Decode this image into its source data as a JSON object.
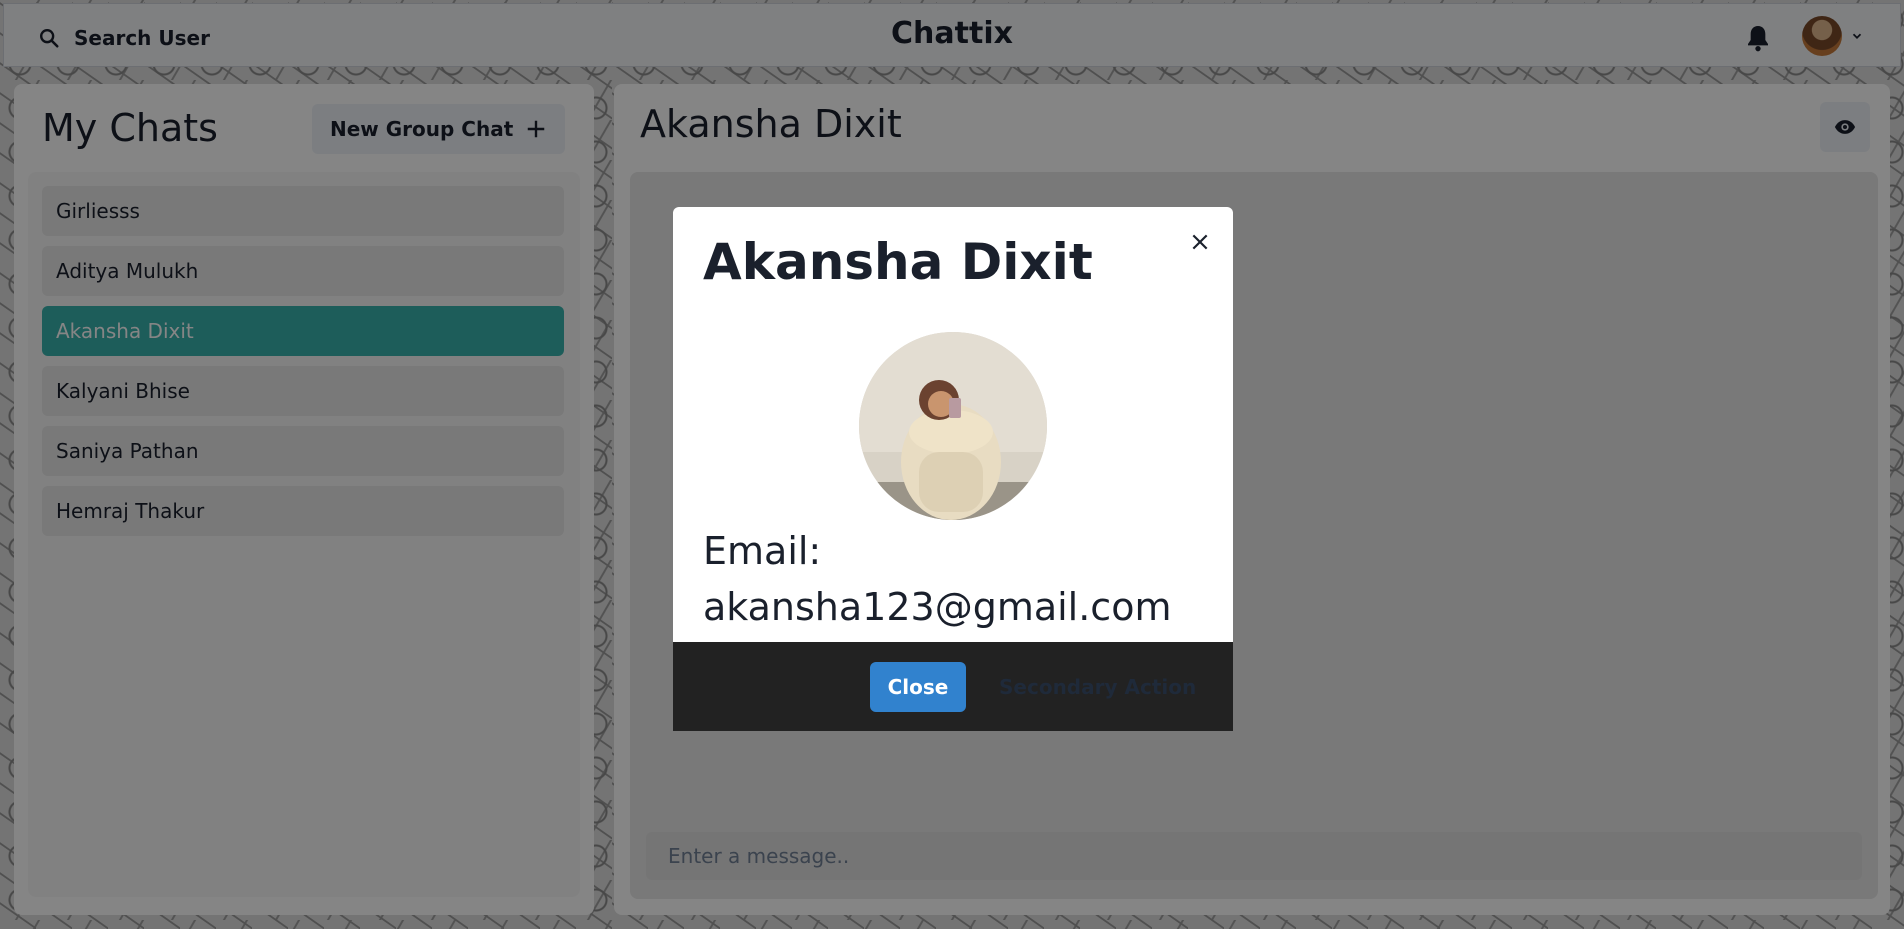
{
  "header": {
    "search_label": "Search User",
    "app_title": "Chattix"
  },
  "left_panel": {
    "title": "My Chats",
    "new_group_label": "New Group Chat",
    "chats": [
      {
        "name": "Girliesss",
        "active": false
      },
      {
        "name": "Aditya Mulukh",
        "active": false
      },
      {
        "name": "Akansha Dixit",
        "active": true
      },
      {
        "name": "Kalyani Bhise",
        "active": false
      },
      {
        "name": "Saniya Pathan",
        "active": false
      },
      {
        "name": "Hemraj Thakur",
        "active": false
      }
    ]
  },
  "chat": {
    "title": "Akansha Dixit",
    "input_placeholder": "Enter a message.."
  },
  "modal": {
    "title": "Akansha Dixit",
    "email_line1": "Email:",
    "email_line2": "akansha123@gmail.com",
    "close_label": "Close",
    "secondary_label": "Secondary Action"
  },
  "colors": {
    "active_chat": "#38b2ac",
    "close_button": "#3182ce",
    "modal_footer": "#222222"
  },
  "icons": [
    "search-icon",
    "bell-icon",
    "chevron-down-icon",
    "plus-icon",
    "eye-icon",
    "close-icon"
  ]
}
